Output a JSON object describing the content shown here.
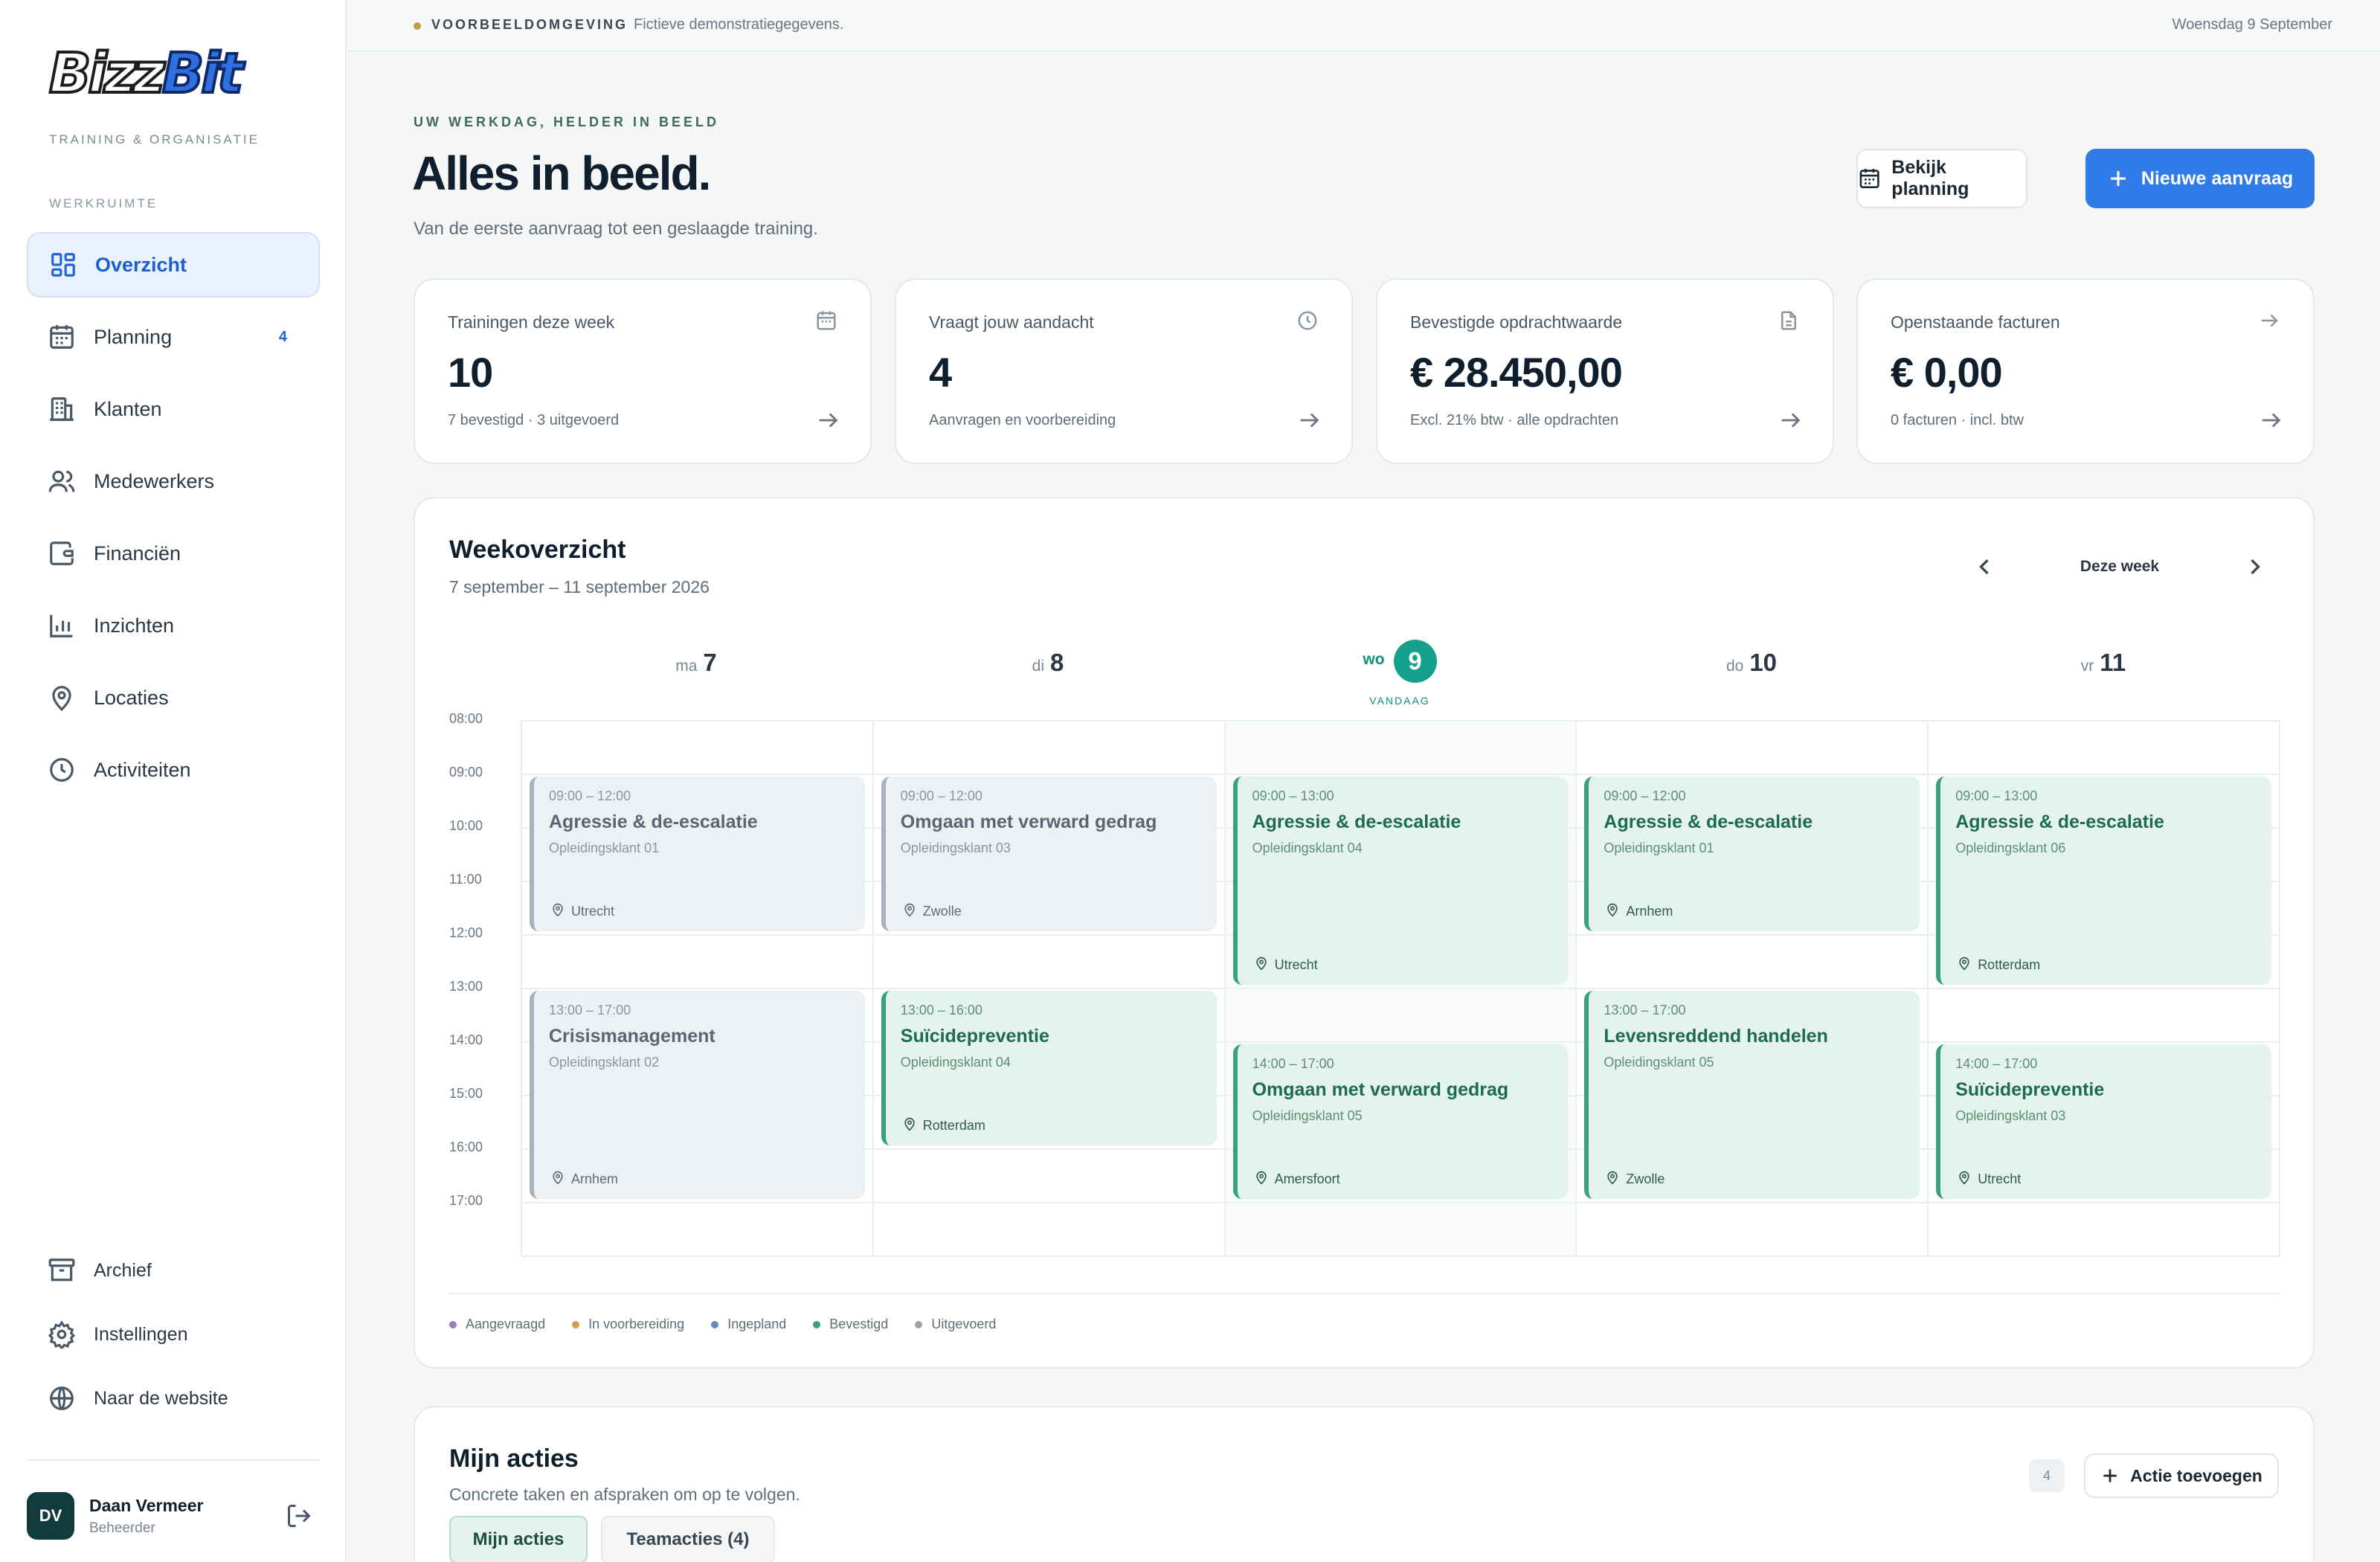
{
  "sidebar": {
    "logo_text": "BizzBit",
    "logo_bizz": "Bizz",
    "logo_bit": "Bit",
    "tagline": "TRAINING & ORGANISATIE",
    "section_label": "WERKRUIMTE",
    "items": [
      {
        "label": "Overzicht",
        "icon": "grid-icon",
        "active": true
      },
      {
        "label": "Planning",
        "icon": "calendar-icon",
        "badge": "4"
      },
      {
        "label": "Klanten",
        "icon": "building-icon"
      },
      {
        "label": "Medewerkers",
        "icon": "users-icon"
      },
      {
        "label": "Financiën",
        "icon": "wallet-icon"
      },
      {
        "label": "Inzichten",
        "icon": "bar-chart-icon"
      },
      {
        "label": "Locaties",
        "icon": "map-pin-icon"
      },
      {
        "label": "Activiteiten",
        "icon": "clock-icon"
      }
    ],
    "bottom_items": [
      {
        "label": "Archief",
        "icon": "archive-icon"
      },
      {
        "label": "Instellingen",
        "icon": "gear-icon"
      },
      {
        "label": "Naar de website",
        "icon": "globe-icon"
      }
    ],
    "user": {
      "initials": "DV",
      "name": "Daan Vermeer",
      "role": "Beheerder"
    }
  },
  "topbar": {
    "env_label": "VOORBEELDOMGEVING",
    "env_text": "Fictieve demonstratiegegevens.",
    "date": "Woensdag 9 September"
  },
  "header": {
    "eyebrow": "UW WERKDAG, HELDER IN BEELD",
    "title": "Alles in beeld.",
    "subtitle": "Van de eerste aanvraag tot een geslaagde training.",
    "btn_planning": "Bekijk planning",
    "btn_new": "Nieuwe aanvraag"
  },
  "stats": [
    {
      "label": "Trainingen deze week",
      "value": "10",
      "sub": "7 bevestigd · 3 uitgevoerd",
      "icon": "calendar-icon"
    },
    {
      "label": "Vraagt jouw aandacht",
      "value": "4",
      "sub": "Aanvragen en voorbereiding",
      "icon": "clock-icon"
    },
    {
      "label": "Bevestigde opdrachtwaarde",
      "value": "€ 28.450,00",
      "sub": "Excl. 21% btw · alle opdrachten",
      "icon": "document-icon"
    },
    {
      "label": "Openstaande facturen",
      "value": "€ 0,00",
      "sub": "0 facturen · incl. btw",
      "icon": "arrow-right-icon"
    }
  ],
  "week": {
    "title": "Weekoverzicht",
    "range": "7 september – 11 september 2026",
    "nav_label": "Deze week",
    "today_label": "VANDAAG",
    "days": [
      {
        "abbr": "ma",
        "num": "7"
      },
      {
        "abbr": "di",
        "num": "8"
      },
      {
        "abbr": "wo",
        "num": "9",
        "today": true
      },
      {
        "abbr": "do",
        "num": "10"
      },
      {
        "abbr": "vr",
        "num": "11"
      }
    ],
    "hours": [
      "08:00",
      "09:00",
      "10:00",
      "11:00",
      "12:00",
      "13:00",
      "14:00",
      "15:00",
      "16:00",
      "17:00"
    ],
    "events": [
      {
        "day": 0,
        "start": 9,
        "end": 12,
        "status": "grey",
        "time": "09:00 – 12:00",
        "title": "Agressie & de-escalatie",
        "client": "Opleidingsklant 01",
        "location": "Utrecht"
      },
      {
        "day": 1,
        "start": 9,
        "end": 12,
        "status": "grey",
        "time": "09:00 – 12:00",
        "title": "Omgaan met verward gedrag",
        "client": "Opleidingsklant 03",
        "location": "Zwolle"
      },
      {
        "day": 2,
        "start": 9,
        "end": 13,
        "status": "green",
        "time": "09:00 – 13:00",
        "title": "Agressie & de-escalatie",
        "client": "Opleidingsklant 04",
        "location": "Utrecht"
      },
      {
        "day": 3,
        "start": 9,
        "end": 12,
        "status": "green",
        "time": "09:00 – 12:00",
        "title": "Agressie & de-escalatie",
        "client": "Opleidingsklant 01",
        "location": "Arnhem"
      },
      {
        "day": 4,
        "start": 9,
        "end": 13,
        "status": "green",
        "time": "09:00 – 13:00",
        "title": "Agressie & de-escalatie",
        "client": "Opleidingsklant 06",
        "location": "Rotterdam"
      },
      {
        "day": 0,
        "start": 13,
        "end": 17,
        "status": "grey",
        "time": "13:00 – 17:00",
        "title": "Crisismanagement",
        "client": "Opleidingsklant 02",
        "location": "Arnhem"
      },
      {
        "day": 1,
        "start": 13,
        "end": 16,
        "status": "green",
        "time": "13:00 – 16:00",
        "title": "Suïcidepreventie",
        "client": "Opleidingsklant 04",
        "location": "Rotterdam"
      },
      {
        "day": 2,
        "start": 14,
        "end": 17,
        "status": "green",
        "time": "14:00 – 17:00",
        "title": "Omgaan met verward gedrag",
        "client": "Opleidingsklant 05",
        "location": "Amersfoort"
      },
      {
        "day": 3,
        "start": 13,
        "end": 17,
        "status": "green",
        "time": "13:00 – 17:00",
        "title": "Levensreddend handelen",
        "client": "Opleidingsklant 05",
        "location": "Zwolle"
      },
      {
        "day": 4,
        "start": 14,
        "end": 17,
        "status": "green",
        "time": "14:00 – 17:00",
        "title": "Suïcidepreventie",
        "client": "Opleidingsklant 03",
        "location": "Utrecht"
      }
    ],
    "legend": [
      {
        "label": "Aangevraagd",
        "color": "#9b7fb8"
      },
      {
        "label": "In voorbereiding",
        "color": "#d2a04c"
      },
      {
        "label": "Ingepland",
        "color": "#5f8fb8"
      },
      {
        "label": "Bevestigd",
        "color": "#3aa07d"
      },
      {
        "label": "Uitgevoerd",
        "color": "#9aa4ae"
      }
    ]
  },
  "actions": {
    "title": "Mijn acties",
    "subtitle": "Concrete taken en afspraken om op te volgen.",
    "count": "4",
    "btn_add": "Actie toevoegen",
    "tab_mine": "Mijn acties",
    "tab_team": "Teamacties (4)"
  }
}
